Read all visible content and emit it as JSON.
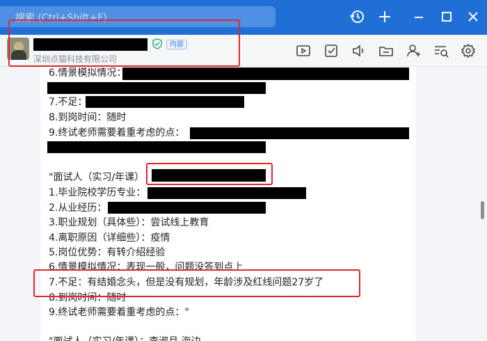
{
  "search": {
    "placeholder": "搜索 (Ctrl+Shift+F)"
  },
  "titlebar": {
    "history_icon": "history-icon",
    "add_icon": "plus-icon",
    "minimize_icon": "minimize-icon",
    "maximize_icon": "maximize-icon",
    "close_icon": "close-icon"
  },
  "chat_header": {
    "badge": "内部",
    "company": "深圳点猫科技有限公司",
    "toolbar_icons": [
      "video-icon",
      "task-icon",
      "voice-icon",
      "folder-icon",
      "add-member-icon",
      "search-records-icon",
      "settings-icon"
    ]
  },
  "content": {
    "lines": [
      "6.情景模拟情况：",
      "7.不足：",
      "8.到岗时间：随时",
      "9.终试老师需要着重考虑的点：",
      "\"面试人（实习/年课）",
      "1.毕业院校学历专业：",
      "2.从业经历：",
      "3.职业规划（具体些）：尝试线上教育",
      "4.离职原因（详细些）：疫情",
      "5.岗位优势：有转介绍经验",
      "6.情景模拟情况：表现一般，问题没答到点上",
      "7.不足：有结婚念头，但是没有规划，年龄涉及红线问题27岁了",
      "8.到岗时间：随时",
      "9.终试老师需要着重考虑的点：\"",
      "\"面试人（实习/年课）：李淑月 海边"
    ]
  },
  "colors": {
    "titlebar": "#1f6fd6",
    "highlight_box": "#e3262a",
    "redaction": "#000000"
  }
}
